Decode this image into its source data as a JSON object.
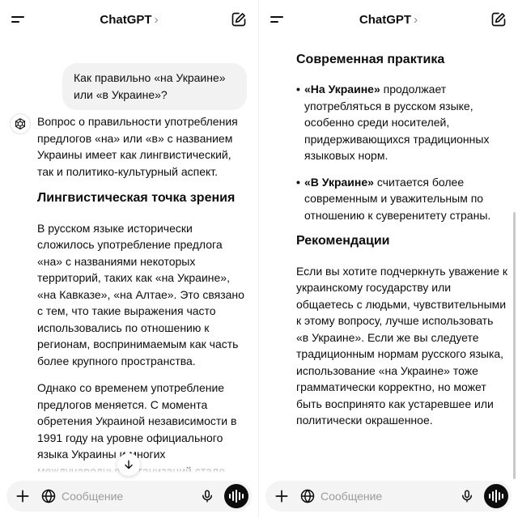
{
  "app": {
    "title": "ChatGPT",
    "title_chevron": "›"
  },
  "chat": {
    "user_message": "Как правильно «на Украине» или «в Украине»?",
    "intro": "Вопрос о правильности употребления предлогов «на» или «в» с названием Украины имеет как лингвистический, так и политико-культурный аспект.",
    "section1_title": "Лингвистическая точка зрения",
    "section1_p1": "В русском языке исторически сложилось употребление предлога «на» с названиями некоторых территорий, таких как «на Украине», «на Кавказе», «на Алтае». Это связано с тем, что такие выражения часто использовались по отношению к регионам, воспринимаемым как часть более крупного пространства.",
    "section1_p2": "Однако со временем употребление предлогов меняется. С момента обретения Украиной независимости в 1991 году на уровне официального языка Украины и многих международных организаций стало принято использовать форму «в Украине», подчеркивая государственность страны.",
    "section2_title": "Современная практика",
    "bullet1_bold": "«На Украине»",
    "bullet1_text": " продолжает употребляться в русском языке, особенно среди носителей, придерживающихся традиционных языковых норм.",
    "bullet2_bold": "«В Украине»",
    "bullet2_text": " считается более современным и уважительным по отношению к суверенитету страны.",
    "section3_title": "Рекомендации",
    "section3_p": "Если вы хотите подчеркнуть уважение к украинскому государству или общаетесь с людьми, чувствительными к этому вопросу, лучше использовать «в Украине». Если же вы следуете традиционным нормам русского языка, использование «на Украине» тоже грамматически корректно, но может быть воспринято как устаревшее или политически окрашенное."
  },
  "composer": {
    "placeholder": "Сообщение"
  },
  "icons": {
    "menu": "menu-icon",
    "edit": "new-chat-icon",
    "plus": "plus-icon",
    "globe": "globe-icon",
    "mic": "mic-icon",
    "voice": "voice-mode-icon",
    "scroll": "arrow-down-icon",
    "logo": "openai-logo-icon"
  },
  "colors": {
    "text": "#0d0d0d",
    "bubble": "#f2f2f2",
    "composer": "#f4f4f4",
    "placeholder": "#9b9b9b"
  }
}
